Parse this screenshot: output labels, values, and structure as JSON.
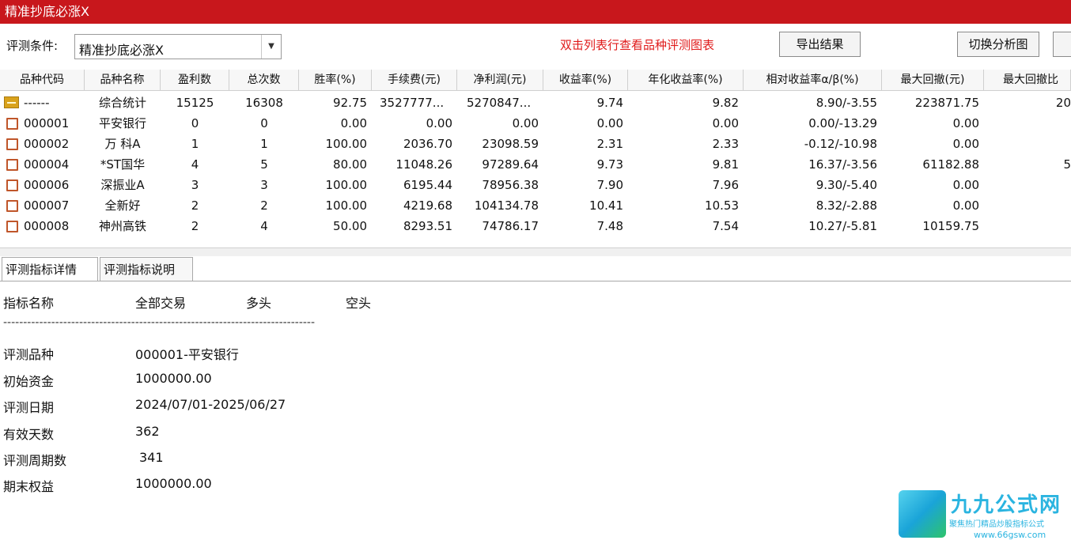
{
  "window": {
    "title": "精准抄底必涨X"
  },
  "toolbar": {
    "condition_label": "评测条件:",
    "condition_value": "精准抄底必涨X",
    "hint": "双击列表行查看品种评测图表",
    "export_label": "导出结果",
    "switch_label": "切换分析图"
  },
  "table": {
    "columns": [
      "品种代码",
      "品种名称",
      "盈利数",
      "总次数",
      "胜率(%)",
      "手续费(元)",
      "净利润(元)",
      "收益率(%)",
      "年化收益率(%)",
      "相对收益率α/β(%)",
      "最大回撤(元)",
      "最大回撤比"
    ],
    "summary": {
      "code": "------",
      "name": "综合统计",
      "wins": "15125",
      "total": "16308",
      "winrate": "92.75",
      "fee": "3527777...",
      "profit": "5270847...",
      "ret": "9.74",
      "annual": "9.82",
      "relative": "8.90/-3.55",
      "drawdown": "223871.75",
      "ddratio": "20"
    },
    "rows": [
      {
        "code": "000001",
        "name": "平安银行",
        "wins": "0",
        "total": "0",
        "winrate": "0.00",
        "fee": "0.00",
        "profit": "0.00",
        "ret": "0.00",
        "annual": "0.00",
        "relative": "0.00/-13.29",
        "drawdown": "0.00",
        "ddratio": ""
      },
      {
        "code": "000002",
        "name": "万 科A",
        "wins": "1",
        "total": "1",
        "winrate": "100.00",
        "fee": "2036.70",
        "profit": "23098.59",
        "ret": "2.31",
        "annual": "2.33",
        "relative": "-0.12/-10.98",
        "drawdown": "0.00",
        "ddratio": ""
      },
      {
        "code": "000004",
        "name": "*ST国华",
        "wins": "4",
        "total": "5",
        "winrate": "80.00",
        "fee": "11048.26",
        "profit": "97289.64",
        "ret": "9.73",
        "annual": "9.81",
        "relative": "16.37/-3.56",
        "drawdown": "61182.88",
        "ddratio": "5"
      },
      {
        "code": "000006",
        "name": "深振业A",
        "wins": "3",
        "total": "3",
        "winrate": "100.00",
        "fee": "6195.44",
        "profit": "78956.38",
        "ret": "7.90",
        "annual": "7.96",
        "relative": "9.30/-5.40",
        "drawdown": "0.00",
        "ddratio": ""
      },
      {
        "code": "000007",
        "name": "全新好",
        "wins": "2",
        "total": "2",
        "winrate": "100.00",
        "fee": "4219.68",
        "profit": "104134.78",
        "ret": "10.41",
        "annual": "10.53",
        "relative": "8.32/-2.88",
        "drawdown": "0.00",
        "ddratio": ""
      },
      {
        "code": "000008",
        "name": "神州高铁",
        "wins": "2",
        "total": "4",
        "winrate": "50.00",
        "fee": "8293.51",
        "profit": "74786.17",
        "ret": "7.48",
        "annual": "7.54",
        "relative": "10.27/-5.81",
        "drawdown": "10159.75",
        "ddratio": ""
      }
    ]
  },
  "tabs": [
    "评测指标详情",
    "评测指标说明"
  ],
  "detail": {
    "headers": [
      "指标名称",
      "全部交易",
      "多头",
      "空头"
    ],
    "separator": "------------------------------------------------------------------------------",
    "items": [
      {
        "label": "评测品种",
        "value": "000001-平安银行"
      },
      {
        "label": "初始资金",
        "value": "1000000.00"
      },
      {
        "label": "评测日期",
        "value": "2024/07/01-2025/06/27"
      },
      {
        "label": "有效天数",
        "value": "362"
      },
      {
        "label": "评测周期数",
        "value": "341"
      },
      {
        "label": "期末权益",
        "value": "1000000.00"
      }
    ]
  },
  "watermark": {
    "title": "九九公式网",
    "subtitle": "聚焦热门精品炒股指标公式",
    "url": "www.66gsw.com"
  }
}
